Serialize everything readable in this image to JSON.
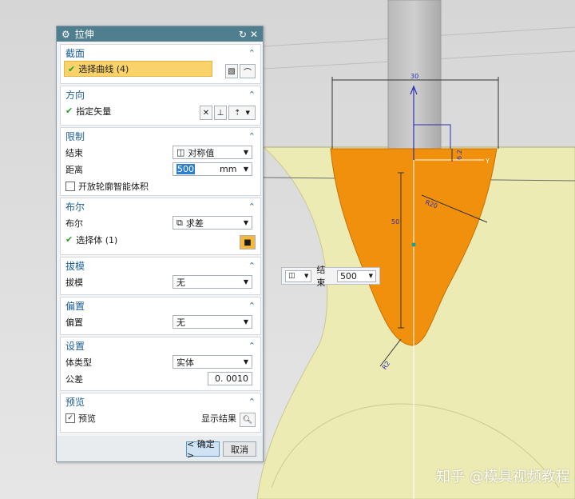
{
  "dialog": {
    "title": "拉伸",
    "sections": {
      "section": {
        "header": "截面",
        "select_curve": "选择曲线 (4)"
      },
      "direction": {
        "header": "方向",
        "specify_vector": "指定矢量"
      },
      "limits": {
        "header": "限制",
        "end_label": "结束",
        "end_value": "对称值",
        "distance_label": "距离",
        "distance_value": "500",
        "distance_unit": "mm",
        "open_profile": "开放轮廓智能体积"
      },
      "boolean": {
        "header": "布尔",
        "boolean_label": "布尔",
        "boolean_value": "求差",
        "select_body": "选择体 (1)"
      },
      "draft": {
        "header": "拔模",
        "draft_label": "拔模",
        "draft_value": "无"
      },
      "offset": {
        "header": "偏置",
        "offset_label": "偏置",
        "offset_value": "无"
      },
      "settings": {
        "header": "设置",
        "body_type_label": "体类型",
        "body_type_value": "实体",
        "tolerance_label": "公差",
        "tolerance_value": "0. 0010"
      },
      "preview": {
        "header": "预览",
        "preview_label": "预览",
        "show_result": "显示结果"
      }
    },
    "buttons": {
      "ok": "< 确定 >",
      "cancel": "取消"
    }
  },
  "viewport": {
    "floating_bar": {
      "end_label": "结束",
      "end_value": "500"
    },
    "dimensions": {
      "d_top": "30",
      "d_small": "6.2",
      "d_radius_top": "R20",
      "d_height": "50",
      "d_radius_bottom": "R2"
    },
    "axis_label": "Y"
  },
  "watermark": "知乎 @模具视频教程",
  "colors": {
    "cut_region": "#f0900c",
    "stock": "#ecebb4",
    "titlebar": "#4f7f8f",
    "selection": "#f9d36a"
  }
}
